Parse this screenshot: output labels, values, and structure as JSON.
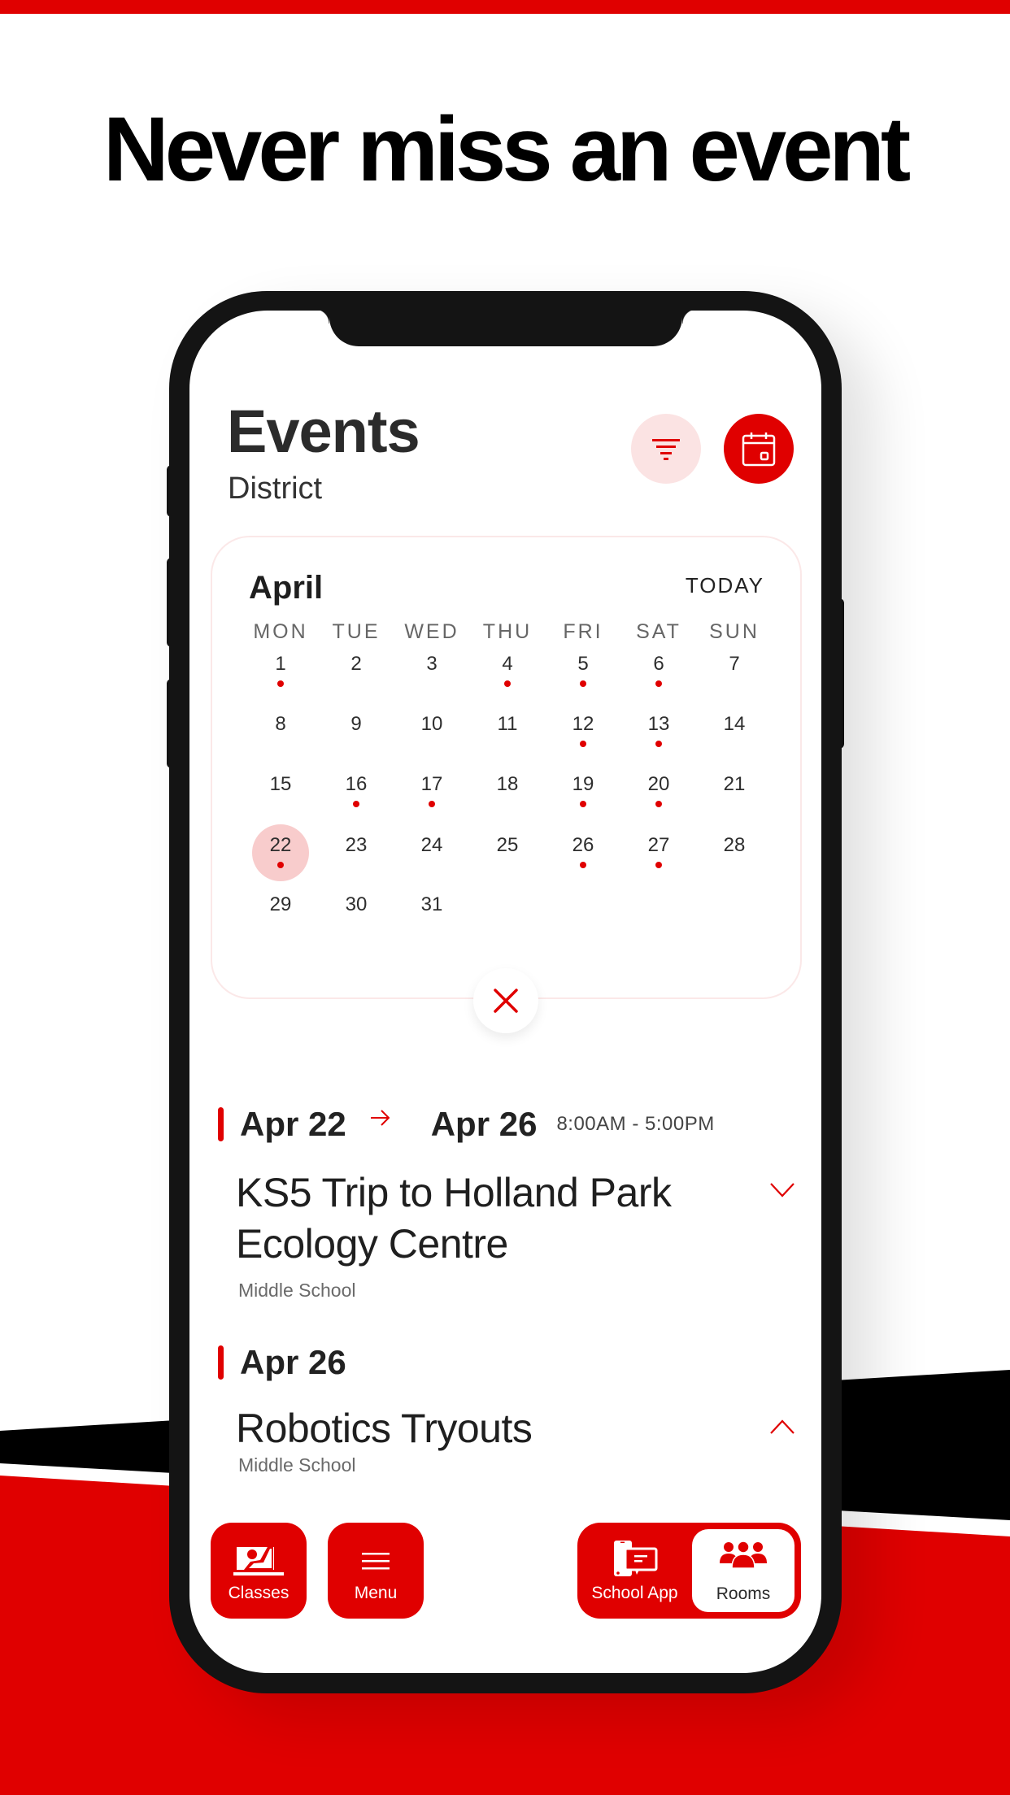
{
  "headline": "Never miss an event",
  "colors": {
    "brand_red": "#e00000",
    "light_red": "#fbe3e3",
    "selected_day": "#f8cccc",
    "black": "#141414"
  },
  "header": {
    "title": "Events",
    "subtitle": "District",
    "filter_icon": "filter-icon",
    "calendar_icon": "calendar-icon"
  },
  "calendar": {
    "month": "April",
    "today_label": "TODAY",
    "weekdays": [
      "MON",
      "TUE",
      "WED",
      "THU",
      "FRI",
      "SAT",
      "SUN"
    ],
    "days": [
      {
        "n": "1",
        "event": true
      },
      {
        "n": "2",
        "event": false
      },
      {
        "n": "3",
        "event": false
      },
      {
        "n": "4",
        "event": true
      },
      {
        "n": "5",
        "event": true
      },
      {
        "n": "6",
        "event": true
      },
      {
        "n": "7",
        "event": false
      },
      {
        "n": "8",
        "event": false
      },
      {
        "n": "9",
        "event": false
      },
      {
        "n": "10",
        "event": false
      },
      {
        "n": "11",
        "event": false
      },
      {
        "n": "12",
        "event": true
      },
      {
        "n": "13",
        "event": true
      },
      {
        "n": "14",
        "event": false
      },
      {
        "n": "15",
        "event": false
      },
      {
        "n": "16",
        "event": true
      },
      {
        "n": "17",
        "event": true
      },
      {
        "n": "18",
        "event": false
      },
      {
        "n": "19",
        "event": true
      },
      {
        "n": "20",
        "event": true
      },
      {
        "n": "21",
        "event": false
      },
      {
        "n": "22",
        "event": true,
        "selected": true
      },
      {
        "n": "23",
        "event": false
      },
      {
        "n": "24",
        "event": false
      },
      {
        "n": "25",
        "event": false
      },
      {
        "n": "26",
        "event": true
      },
      {
        "n": "27",
        "event": true
      },
      {
        "n": "28",
        "event": false
      },
      {
        "n": "29",
        "event": false
      },
      {
        "n": "30",
        "event": false
      },
      {
        "n": "31",
        "event": false
      }
    ],
    "close_icon": "close-icon"
  },
  "events": [
    {
      "start_date": "Apr 22",
      "end_date": "Apr 26",
      "time": "8:00AM  -  5:00PM",
      "title_line1": "KS5 Trip to Holland Park",
      "title_line2": "Ecology Centre",
      "school": "Middle School",
      "expanded": false
    },
    {
      "start_date": "Apr 26",
      "title_line1": "Robotics Tryouts",
      "school": "Middle School",
      "expanded": true
    }
  ],
  "nav": {
    "classes": "Classes",
    "menu": "Menu",
    "school_app": "School App",
    "rooms": "Rooms",
    "active": "Rooms"
  }
}
